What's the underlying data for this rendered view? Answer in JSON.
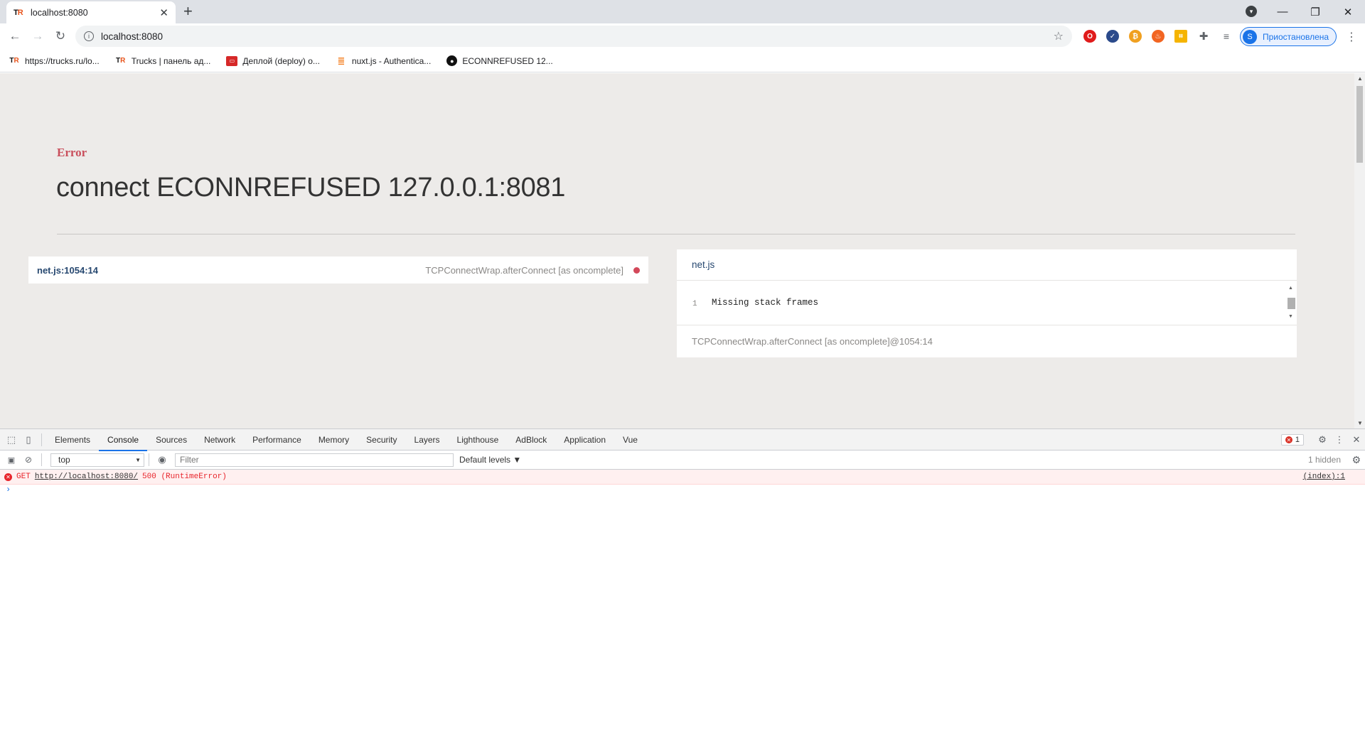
{
  "browser": {
    "tab_title": "localhost:8080",
    "favicon_text_t": "T",
    "favicon_text_r": "R",
    "url": "localhost:8080",
    "profile_initial": "S",
    "profile_label": "Приостановлена"
  },
  "bookmarks": [
    {
      "label": "https://trucks.ru/lo..."
    },
    {
      "label": "Trucks | панель ад..."
    },
    {
      "label": "Деплой (deploy) о..."
    },
    {
      "label": "nuxt.js - Authentica..."
    },
    {
      "label": "ECONNREFUSED 12..."
    }
  ],
  "page": {
    "error_label": "Error",
    "error_message": "connect ECONNREFUSED 127.0.0.1:8081",
    "frame": {
      "file": "net.js:1054:14",
      "function": "TCPConnectWrap.afterConnect [as oncomplete]"
    },
    "source": {
      "filename": "net.js",
      "line_number": "1",
      "line_text": "Missing stack frames",
      "footer": "TCPConnectWrap.afterConnect [as oncomplete]@1054:14"
    }
  },
  "devtools": {
    "tabs": [
      "Elements",
      "Console",
      "Sources",
      "Network",
      "Performance",
      "Memory",
      "Security",
      "Layers",
      "Lighthouse",
      "AdBlock",
      "Application",
      "Vue"
    ],
    "active_tab": "Console",
    "error_count": "1",
    "context": "top",
    "filter_placeholder": "Filter",
    "levels": "Default levels ▼",
    "hidden": "1 hidden",
    "console_error": {
      "method": "GET",
      "url": "http://localhost:8080/",
      "status": "500 (RuntimeError)",
      "source": "(index):1"
    },
    "prompt": "›"
  },
  "colors": {
    "error_red": "#c94f5c",
    "accent_blue": "#1a73e8",
    "page_bg": "#edebe9"
  }
}
